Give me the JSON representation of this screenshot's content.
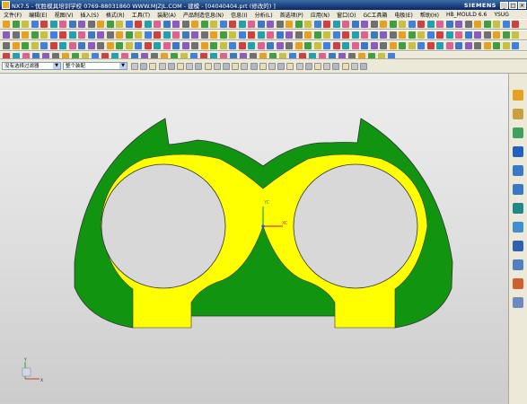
{
  "window": {
    "title": "NX7.5 - 优胜模具培训学校 0769-88031860 WWW.MJZJL.COM - 建模 - [04040404.prt (修改的) ]",
    "brand": "SIEMENS",
    "controls": [
      "_",
      "□",
      "×"
    ]
  },
  "menu": {
    "items": [
      "文件(F)",
      "编辑(E)",
      "视图(V)",
      "插入(S)",
      "格式(R)",
      "工具(T)",
      "装配(A)",
      "产品制造信息(N)",
      "信息(I)",
      "分析(L)",
      "首选项(P)",
      "应用(N)",
      "窗口(O)",
      "GC工具箱",
      "电极(E)",
      "帮助(H)",
      "HB_MOULD 6.6",
      "YSUG"
    ]
  },
  "selection": {
    "filter_value": "没有选择过滤器",
    "scope_value": "整个装配"
  },
  "colors": {
    "part_outer": "#119511",
    "part_inner": "#ffff00",
    "part_edge": "#333333",
    "hole_fill": "#d8d8d8",
    "wcs_y": "#22aa22",
    "wcs_x": "#dd3333",
    "wcs_z": "#2266ff"
  },
  "viewport": {
    "wcs_labels": {
      "y": "YC",
      "x": "XC"
    },
    "triad_labels": {
      "x": "X",
      "y": "Y",
      "z": "Z"
    }
  }
}
